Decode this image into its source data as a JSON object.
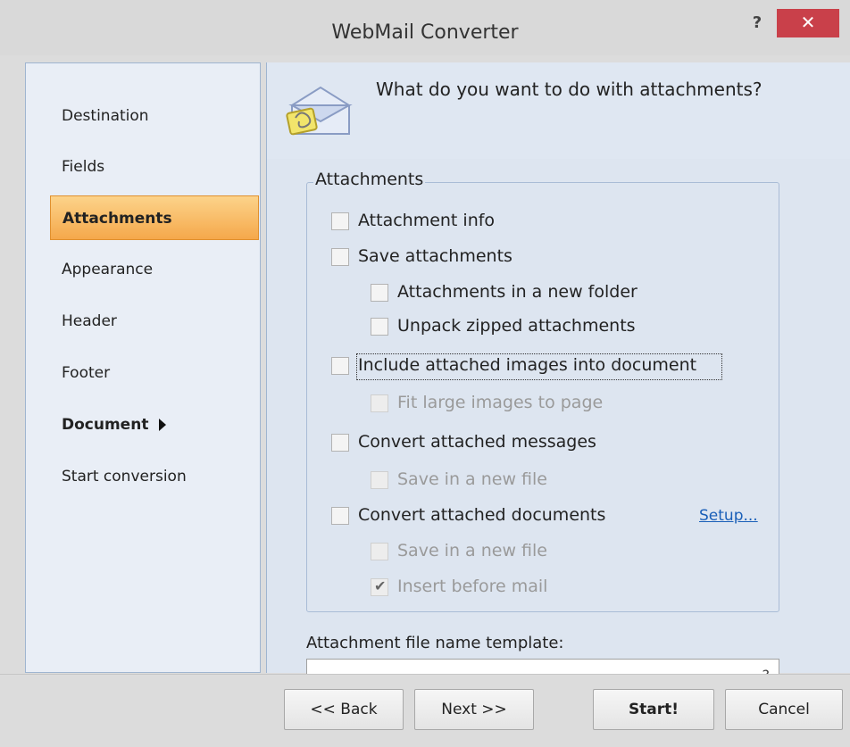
{
  "window": {
    "title": "WebMail Converter",
    "help_label": "?",
    "close_label": "✕"
  },
  "nav": {
    "items": [
      {
        "label": "Destination"
      },
      {
        "label": "Fields"
      },
      {
        "label": "Attachments"
      },
      {
        "label": "Appearance"
      },
      {
        "label": "Header"
      },
      {
        "label": "Footer"
      },
      {
        "label": "Document"
      },
      {
        "label": "Start conversion"
      }
    ]
  },
  "page": {
    "question": "What do you want to do with attachments?",
    "group_title": "Attachments",
    "options": [
      {
        "label": "Attachment info",
        "checked": false,
        "enabled": true
      },
      {
        "label": "Save attachments",
        "checked": false,
        "enabled": true
      },
      {
        "label": "Attachments in a new folder",
        "checked": false,
        "enabled": true
      },
      {
        "label": "Unpack zipped attachments",
        "checked": false,
        "enabled": true
      },
      {
        "label": "Include attached images into document",
        "checked": false,
        "enabled": true
      },
      {
        "label": "Fit large images to page",
        "checked": false,
        "enabled": false
      },
      {
        "label": "Convert attached messages",
        "checked": false,
        "enabled": true
      },
      {
        "label": "Save in a new file",
        "checked": false,
        "enabled": false
      },
      {
        "label": "Convert attached documents",
        "checked": false,
        "enabled": true
      },
      {
        "label": "Save in a new file",
        "checked": false,
        "enabled": false
      },
      {
        "label": "Insert before mail",
        "checked": true,
        "enabled": false
      }
    ],
    "setup_link": "Setup...",
    "template_label": "Attachment file name template:",
    "template_value": "",
    "template_glyph": "?"
  },
  "buttons": {
    "back": "<< Back",
    "next": "Next >>",
    "start": "Start!",
    "cancel": "Cancel"
  },
  "colors": {
    "accent_active": "#f5a84b",
    "close": "#c9404a",
    "link": "#1a5fb8"
  }
}
